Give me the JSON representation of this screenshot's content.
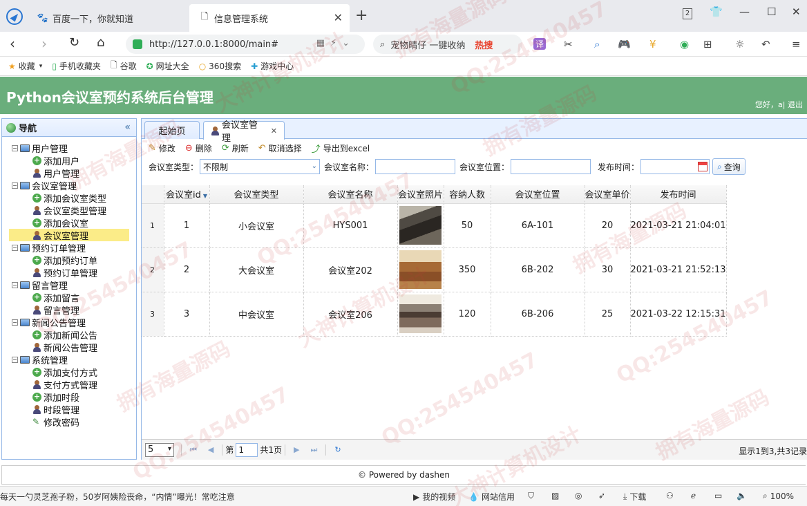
{
  "browser": {
    "tabs": [
      {
        "title": "百度一下，你就知道"
      },
      {
        "title": "信息管理系统"
      }
    ],
    "tab_count": "2",
    "url": "http://127.0.0.1:8000/main#",
    "search_text": "宠物晴仔 一键收纳",
    "search_hot": "热搜",
    "translate_label": "译",
    "bookmarks": [
      {
        "label": "收藏",
        "icon": "star-icon"
      },
      {
        "label": "手机收藏夹",
        "icon": "phone-icon"
      },
      {
        "label": "谷歌",
        "icon": "page-icon"
      },
      {
        "label": "网址大全",
        "icon": "compass-icon"
      },
      {
        "label": "360搜索",
        "icon": "search-icon"
      },
      {
        "label": "游戏中心",
        "icon": "gamepad-icon"
      }
    ]
  },
  "app": {
    "title": "Python会议室预约系统后台管理",
    "user_greeting": "您好，a|",
    "logout": "退出"
  },
  "nav": {
    "title": "导航",
    "groups": [
      {
        "label": "用户管理",
        "items": [
          {
            "label": "添加用户",
            "icon": "add-icon"
          },
          {
            "label": "用户管理",
            "icon": "user-icon"
          }
        ]
      },
      {
        "label": "会议室管理",
        "items": [
          {
            "label": "添加会议室类型",
            "icon": "add-icon"
          },
          {
            "label": "会议室类型管理",
            "icon": "user-icon"
          },
          {
            "label": "添加会议室",
            "icon": "add-icon"
          },
          {
            "label": "会议室管理",
            "icon": "user-icon",
            "selected": true
          }
        ]
      },
      {
        "label": "预约订单管理",
        "items": [
          {
            "label": "添加预约订单",
            "icon": "add-icon"
          },
          {
            "label": "预约订单管理",
            "icon": "user-icon"
          }
        ]
      },
      {
        "label": "留言管理",
        "items": [
          {
            "label": "添加留言",
            "icon": "add-icon"
          },
          {
            "label": "留言管理",
            "icon": "user-icon"
          }
        ]
      },
      {
        "label": "新闻公告管理",
        "items": [
          {
            "label": "添加新闻公告",
            "icon": "add-icon"
          },
          {
            "label": "新闻公告管理",
            "icon": "user-icon"
          }
        ]
      },
      {
        "label": "系统管理",
        "items": [
          {
            "label": "添加支付方式",
            "icon": "add-icon"
          },
          {
            "label": "支付方式管理",
            "icon": "user-icon"
          },
          {
            "label": "添加时段",
            "icon": "add-icon"
          },
          {
            "label": "时段管理",
            "icon": "user-icon"
          },
          {
            "label": "修改密码",
            "icon": "pen-icon"
          }
        ]
      }
    ]
  },
  "main": {
    "tabs": [
      {
        "label": "起始页"
      },
      {
        "label": "会议室管理"
      }
    ],
    "toolbar": {
      "edit": "修改",
      "delete": "删除",
      "refresh": "刷新",
      "cancel_select": "取消选择",
      "export": "导出到excel"
    },
    "filters": {
      "type_label": "会议室类型：",
      "type_value": "不限制",
      "name_label": "会议室名称：",
      "location_label": "会议室位置：",
      "date_label": "发布时间：",
      "query_button": "查询"
    },
    "grid": {
      "columns": [
        "会议室id",
        "会议室类型",
        "会议室名称",
        "会议室照片",
        "容纳人数",
        "会议室位置",
        "会议室单价",
        "发布时间"
      ],
      "rows": [
        {
          "rownum": "1",
          "id": "1",
          "type": "小会议室",
          "name": "HYS001",
          "capacity": "50",
          "location": "6A-101",
          "price": "20",
          "time": "2021-03-21 21:04:01"
        },
        {
          "rownum": "2",
          "id": "2",
          "type": "大会议室",
          "name": "会议室202",
          "capacity": "350",
          "location": "6B-202",
          "price": "30",
          "time": "2021-03-21 21:52:13"
        },
        {
          "rownum": "3",
          "id": "3",
          "type": "中会议室",
          "name": "会议室206",
          "capacity": "120",
          "location": "6B-206",
          "price": "25",
          "time": "2021-03-22 12:15:31"
        }
      ]
    },
    "pager": {
      "page_size": "5",
      "page_prefix": "第",
      "page_value": "1",
      "page_suffix": "共1页",
      "info": "显示1到3,共3记录"
    }
  },
  "footer": {
    "text": "© Powered by dashen"
  },
  "statusbar": {
    "news": "每天一勺灵芝孢子粉，50岁阿姨险丧命，“内情”曝光！常吃注意",
    "video": "我的视频",
    "credit": "网站信用",
    "download": "下载",
    "zoom": "100%"
  },
  "watermarks": [
    "拥有海量源码",
    "QQ:254540457",
    "大神计算机设计"
  ]
}
